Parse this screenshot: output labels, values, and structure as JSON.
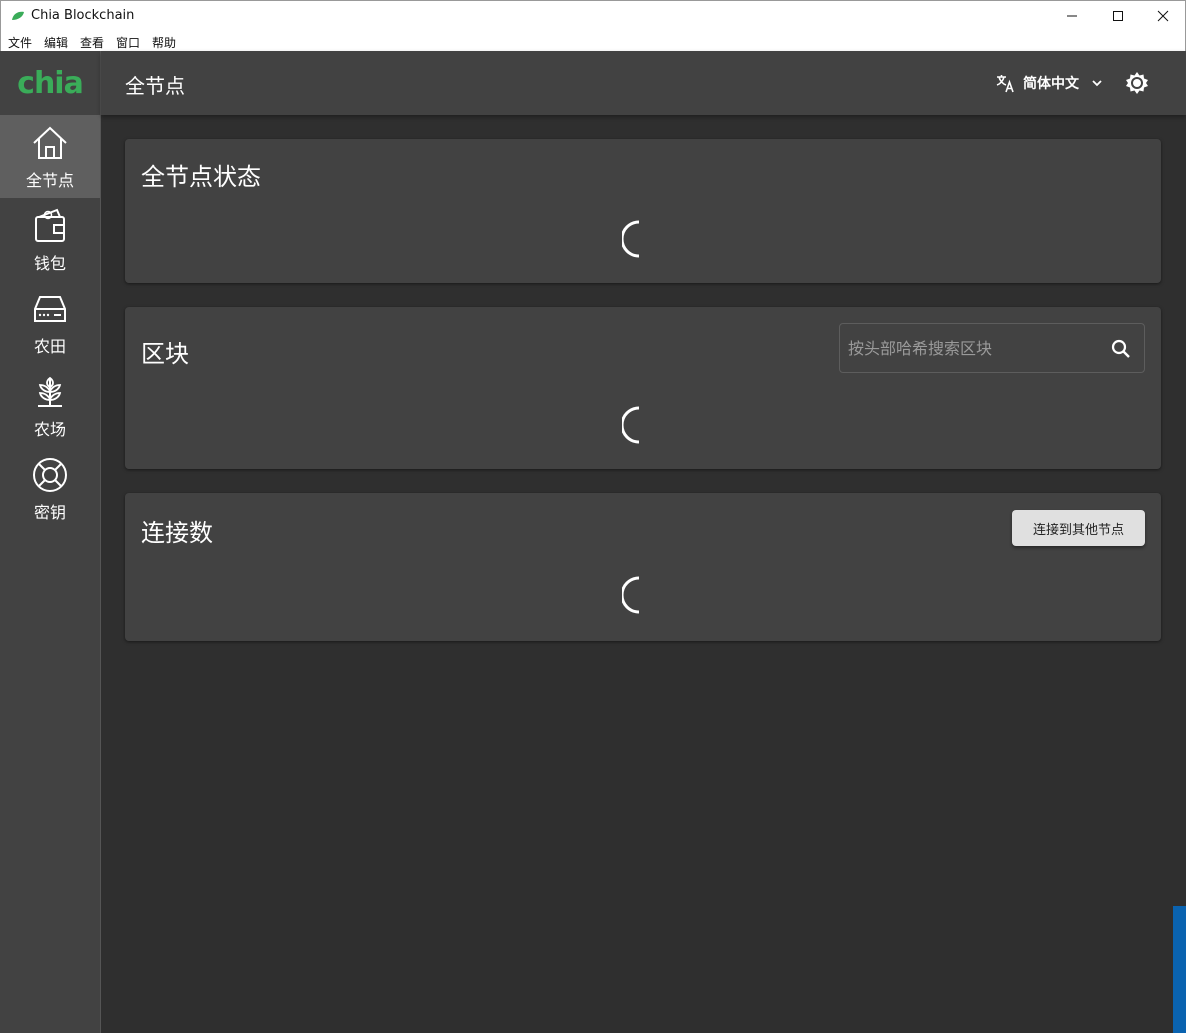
{
  "window": {
    "title": "Chia Blockchain",
    "minimize": "minimize",
    "maximize": "maximize",
    "close": "close"
  },
  "menu": [
    "文件",
    "编辑",
    "查看",
    "窗口",
    "帮助"
  ],
  "logo_text": "chia",
  "sidebar": {
    "items": [
      {
        "label": "全节点",
        "icon": "home-icon",
        "active": true
      },
      {
        "label": "钱包",
        "icon": "wallet-icon",
        "active": false
      },
      {
        "label": "农田",
        "icon": "harddrive-icon",
        "active": false
      },
      {
        "label": "农场",
        "icon": "plant-icon",
        "active": false
      },
      {
        "label": "密钥",
        "icon": "lifebuoy-icon",
        "active": false
      }
    ]
  },
  "topbar": {
    "title": "全节点",
    "language": "简体中文"
  },
  "cards": {
    "status": {
      "title": "全节点状态"
    },
    "blocks": {
      "title": "区块",
      "search_placeholder": "按头部哈希搜索区块"
    },
    "connections": {
      "title": "连接数",
      "button": "连接到其他节点"
    }
  },
  "colors": {
    "brand": "#3aac59",
    "background": "#2f2f2f",
    "panel": "#424242",
    "active_nav": "#5f5f5f"
  }
}
